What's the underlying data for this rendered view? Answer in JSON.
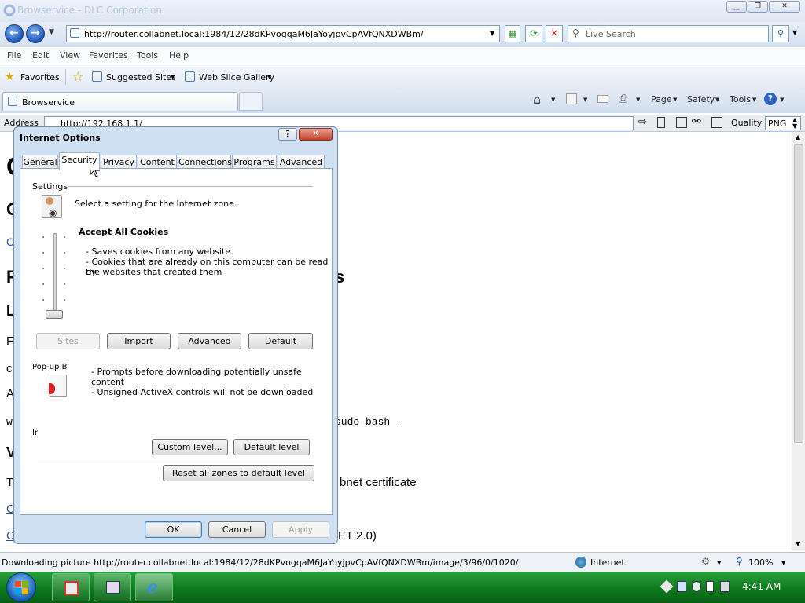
{
  "window": {
    "title": "Browservice - DLC Corporation"
  },
  "nav": {
    "url": "http://router.collabnet.local:1984/12/28dKPvogqaM6JaYoyjpvCpAVfQNXDWBm/",
    "search_placeholder": "Live Search"
  },
  "menu": [
    "File",
    "Edit",
    "View",
    "Favorites",
    "Tools",
    "Help"
  ],
  "favorites": {
    "label": "Favorites",
    "suggested": "Suggested Sites",
    "webslice": "Web Slice Gallery"
  },
  "tab": {
    "label": "Browservice"
  },
  "commandbar": {
    "page": "Page",
    "safety": "Safety",
    "tools": "Tools"
  },
  "inner": {
    "address_label": "Address",
    "address_value": "http://192.168.1.1/",
    "quality_label": "Quality",
    "quality_value": "PNG"
  },
  "page_fragments": {
    "f1": "C",
    "f2": "C",
    "f3": "C",
    "f4": "F",
    "f5": "s",
    "f6": "L",
    "f7": "F",
    "f8": "c",
    "f9": "A",
    "f10": "w",
    "f11": "sudo bash -",
    "f12": "V",
    "f13": "T",
    "f14": "bnet certificate",
    "f15": "C",
    "f16": "C",
    "f17": "ET 2.0)"
  },
  "status": {
    "text": "Downloading picture http://router.collabnet.local:1984/12/28dKPvogqaM6JaYoyjpvCpAVfQNXDWBm/image/3/96/0/1020/",
    "zone": "Internet",
    "zoom": "100%"
  },
  "taskbar": {
    "clock": "4:41 AM"
  },
  "dialog": {
    "title": "Internet Options",
    "help": "?",
    "close": "✕",
    "tabs": [
      "General",
      "Security",
      "Privacy",
      "Content",
      "Connections",
      "Programs",
      "Advanced"
    ],
    "settings_label": "Settings",
    "zone_prompt": "Select a setting for the Internet zone.",
    "level_title": "Accept All Cookies",
    "level_lines": [
      "- Saves cookies from any website.",
      "- Cookies that are already on this computer can be read by",
      "the websites that created them"
    ],
    "buttons_row1": [
      "Sites",
      "Import",
      "Advanced",
      "Default"
    ],
    "popup_label": "Pop-up B",
    "security_lines": [
      "- Prompts before downloading potentially unsafe",
      "content",
      "- Unsigned ActiveX controls will not be downloaded"
    ],
    "ir_fragment": "Ir",
    "custom_level": "Custom level...",
    "default_level": "Default level",
    "reset_all": "Reset all zones to default level",
    "ok": "OK",
    "cancel": "Cancel",
    "apply": "Apply"
  }
}
